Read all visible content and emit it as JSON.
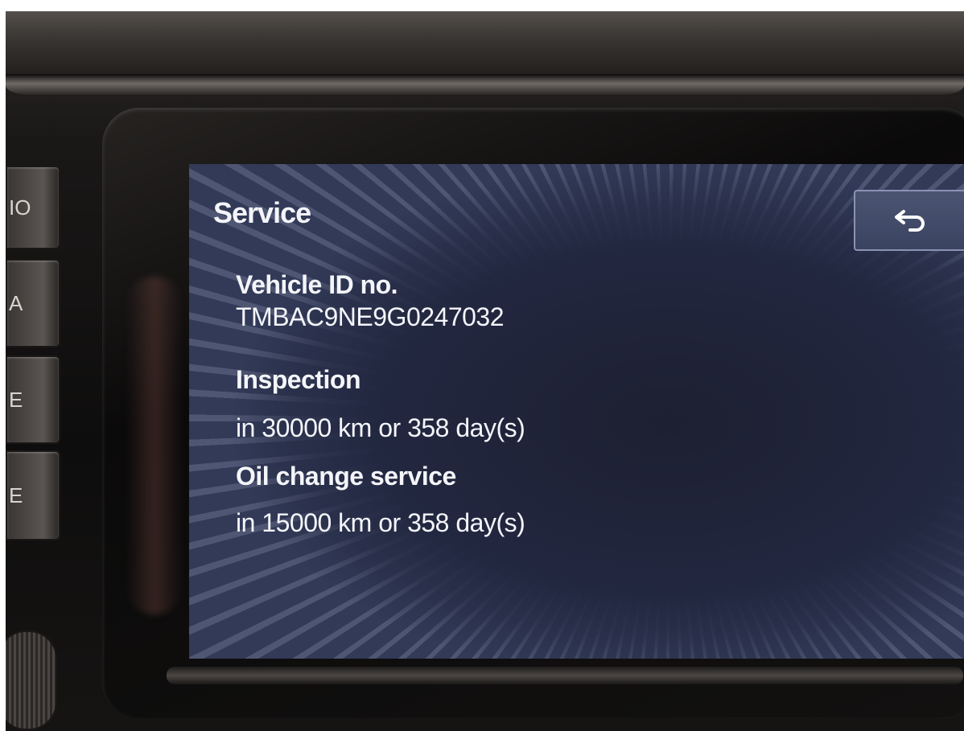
{
  "buttons": {
    "hw1": "IO",
    "hw2": "A",
    "hw3": "E",
    "hw4": "E"
  },
  "screen": {
    "title": "Service",
    "back_icon": "return-arrow-icon",
    "vehicle_id_label": "Vehicle ID no.",
    "vehicle_id_value": "TMBAC9NE9G0247032",
    "inspection_label": "Inspection",
    "inspection_value": "in 30000 km or 358 day(s)",
    "oil_label": "Oil change service",
    "oil_value": "in 15000 km or 358 day(s)"
  },
  "colors": {
    "screen_bg": "#262c44",
    "text": "#f4f5fa",
    "back_button": "#4b5572"
  }
}
